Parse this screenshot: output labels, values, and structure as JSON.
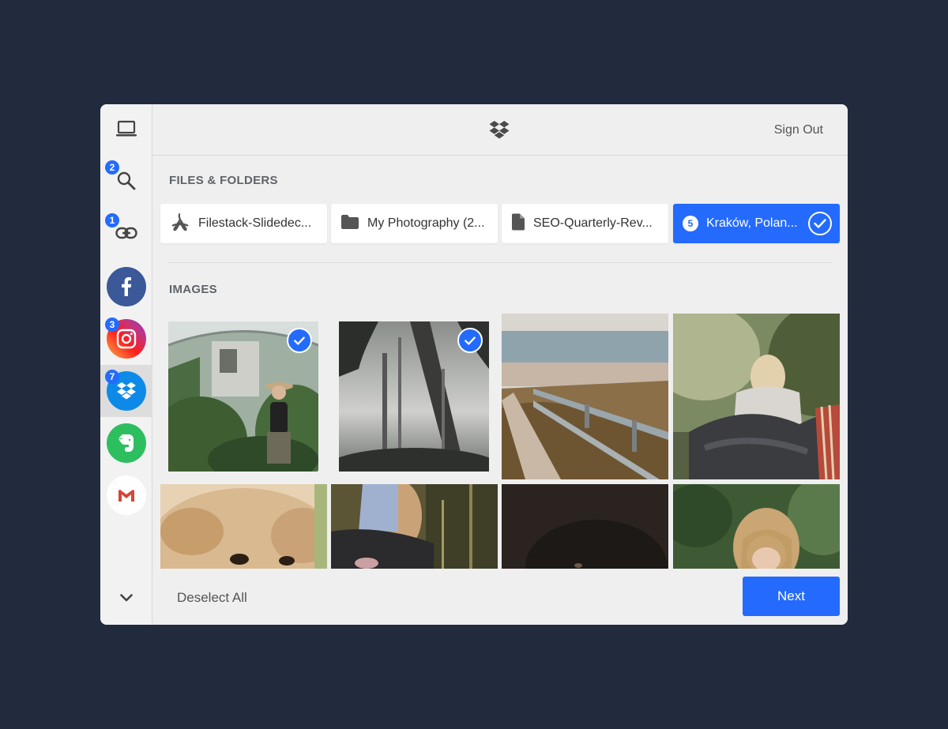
{
  "header": {
    "sign_out_label": "Sign Out",
    "logo_icon": "dropbox-icon"
  },
  "sidebar": {
    "items": [
      {
        "name": "computer",
        "icon": "laptop-icon",
        "badge": ""
      },
      {
        "name": "web-search",
        "icon": "search-icon",
        "badge": "2"
      },
      {
        "name": "link",
        "icon": "link-icon",
        "badge": "1"
      },
      {
        "name": "facebook",
        "icon": "facebook-icon",
        "badge": ""
      },
      {
        "name": "instagram",
        "icon": "instagram-icon",
        "badge": "3"
      },
      {
        "name": "dropbox",
        "icon": "dropbox-icon",
        "badge": "7",
        "active": true
      },
      {
        "name": "evernote",
        "icon": "evernote-icon",
        "badge": ""
      },
      {
        "name": "gmail",
        "icon": "gmail-icon",
        "badge": ""
      }
    ],
    "more_icon": "chevron-down-icon"
  },
  "files_section": {
    "title": "FILES & FOLDERS",
    "items": [
      {
        "name": "Filestack-Slidedec...",
        "icon": "pdf-icon",
        "selected": false
      },
      {
        "name": "My Photography (2...",
        "icon": "folder-icon",
        "selected": false
      },
      {
        "name": "SEO-Quarterly-Rev...",
        "icon": "document-icon",
        "selected": false
      },
      {
        "name": "Kraków, Polan...",
        "icon": "checkmark-icon",
        "selected": true,
        "count": "5"
      }
    ]
  },
  "images_section": {
    "title": "IMAGES",
    "items": [
      {
        "subject": "woman-in-greenhouse",
        "selected": true
      },
      {
        "subject": "misty-forest",
        "selected": true
      },
      {
        "subject": "beach-boardwalk",
        "selected": false
      },
      {
        "subject": "woman-with-blanket",
        "selected": false
      },
      {
        "subject": "fluffy-dog",
        "selected": false
      },
      {
        "subject": "woman-sitting-in-forest",
        "selected": false
      },
      {
        "subject": "black-dog",
        "selected": false
      },
      {
        "subject": "woman-in-plants",
        "selected": false
      }
    ]
  },
  "footer": {
    "deselect_label": "Deselect All",
    "next_label": "Next"
  },
  "colors": {
    "accent": "#246bfd",
    "background": "#212b3d",
    "panel": "#efefef"
  }
}
